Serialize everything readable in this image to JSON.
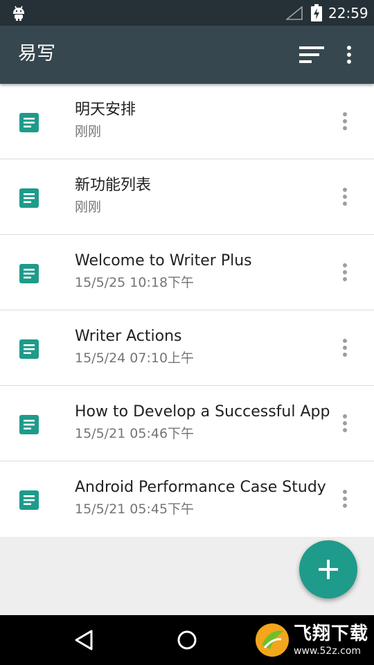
{
  "status_bar": {
    "time": "22:59"
  },
  "app_bar": {
    "title": "易写"
  },
  "notes": [
    {
      "title": "明天安排",
      "date": "刚刚"
    },
    {
      "title": "新功能列表",
      "date": "刚刚"
    },
    {
      "title": "Welcome to Writer Plus",
      "date": "15/5/25 10:18下午"
    },
    {
      "title": "Writer Actions",
      "date": "15/5/24 07:10上午"
    },
    {
      "title": "How to Develop a Successful App",
      "date": "15/5/21 05:46下午"
    },
    {
      "title": "Android Performance Case Study",
      "date": "15/5/21 05:45下午"
    }
  ],
  "watermark": {
    "text": "飞翔下载",
    "url": "www.52z.com"
  },
  "colors": {
    "app_bar": "#37474f",
    "status_bar": "#263137",
    "accent": "#1e9b8a"
  },
  "icons": {
    "status": [
      "android-icon",
      "signal-icon",
      "battery-charging-icon"
    ],
    "app_bar": [
      "sort-icon",
      "more-vert-icon"
    ],
    "list_item": [
      "document-icon",
      "more-vert-icon"
    ],
    "fab": "plus-icon",
    "nav": [
      "back-icon",
      "home-icon"
    ]
  }
}
